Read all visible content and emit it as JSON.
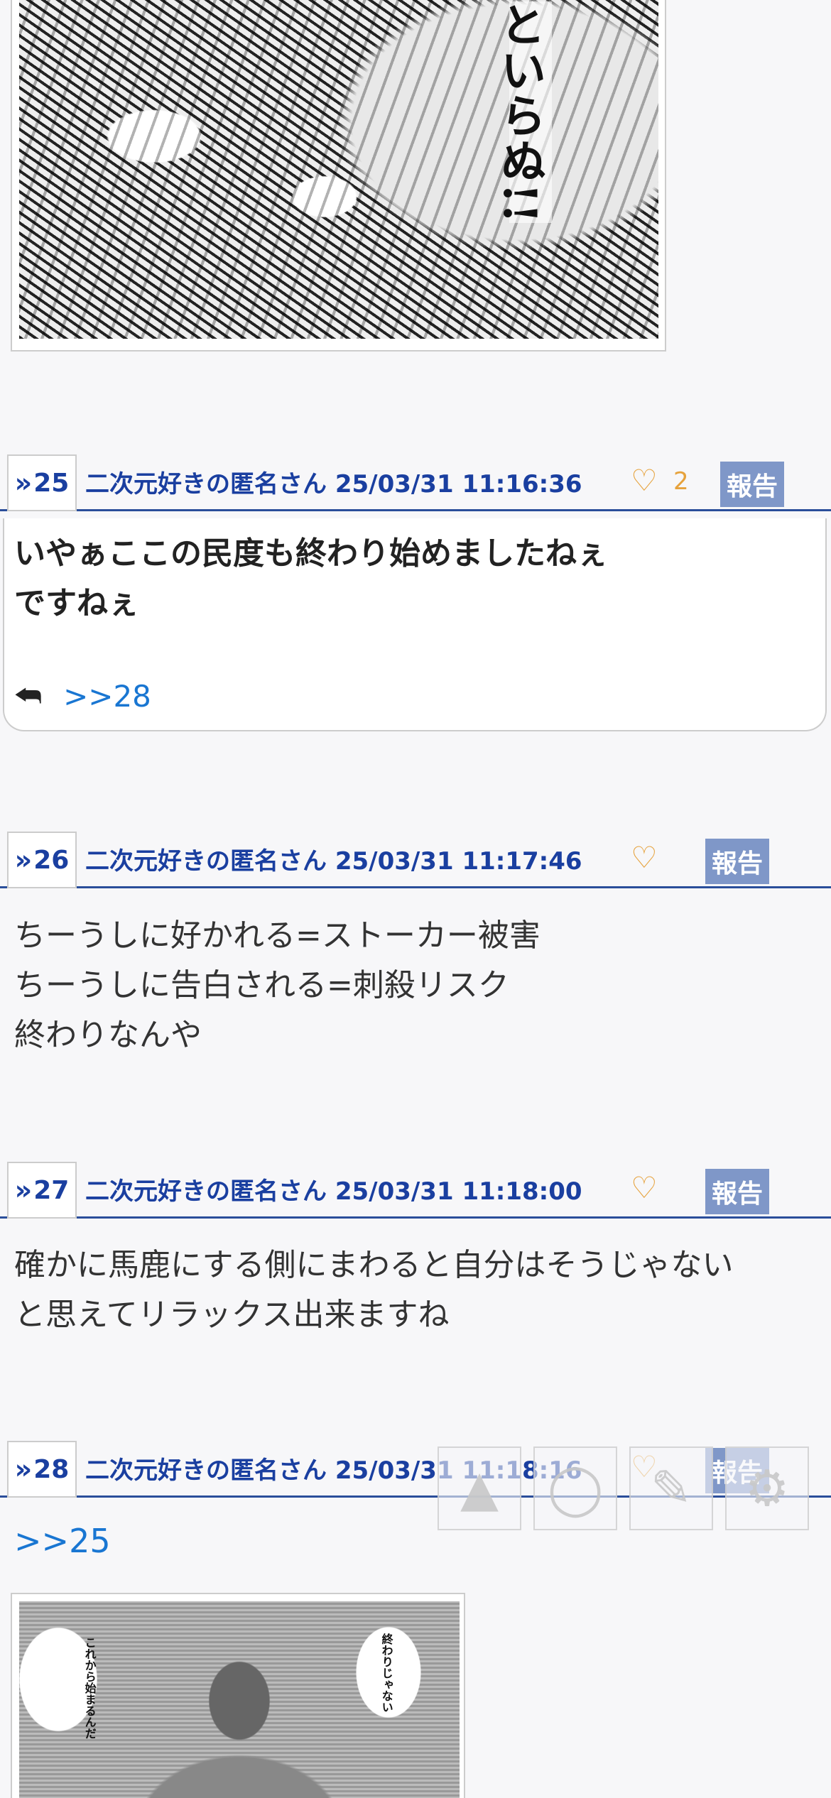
{
  "top_image": {
    "caption_text": "といらぬ!!"
  },
  "posts": [
    {
      "number": "25",
      "meta": "二次元好きの匿名さん 25/03/31 11:16:36",
      "likes": "2",
      "report_label": "報告",
      "body": "いやぁここの民度も終わり始めましたねぇ\nですねぇ",
      "reply_anchor": ">>28"
    },
    {
      "number": "26",
      "meta": "二次元好きの匿名さん 25/03/31 11:17:46",
      "likes": "",
      "report_label": "報告",
      "body": "ちーうしに好かれる=ストーカー被害\nちーうしに告白される=刺殺リスク\n終わりなんや"
    },
    {
      "number": "27",
      "meta": "二次元好きの匿名さん 25/03/31 11:18:00",
      "likes": "",
      "report_label": "報告",
      "body": "確かに馬鹿にする側にまわると自分はそうじゃない\nと思えてリラックス出来ますね"
    },
    {
      "number": "28",
      "meta": "二次元好きの匿名さん 25/03/31 11:18:16",
      "likes": "",
      "report_label": "報告",
      "anchor": ">>25",
      "image_bubble_left": "これから始まるんだ",
      "image_bubble_right": "終わりじゃない"
    }
  ],
  "icons": {
    "number_prefix": "»",
    "heart": "♡",
    "reply": "⮪",
    "scroll_top": "▲",
    "circle": "◯",
    "edit": "✎",
    "settings": "⚙"
  },
  "colors": {
    "accent": "#1a3fa0",
    "heart": "#e6a23c",
    "report_bg": "#7f97c8",
    "link": "#1976d2"
  }
}
